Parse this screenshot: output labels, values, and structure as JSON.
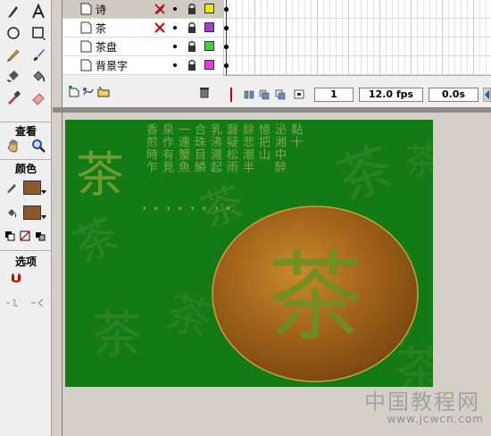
{
  "tools_panel": {
    "sections": {
      "view": "查看",
      "colors": "颜色",
      "options": "选项"
    },
    "tools": [
      "text-tool-icon",
      "oval-tool-icon",
      "rectangle-tool-icon",
      "pencil-tool-icon",
      "brush-tool-icon",
      "ink-bottle-tool-icon",
      "paint-bucket-tool-icon",
      "eyedropper-tool-icon",
      "eraser-tool-icon",
      "hand-tool-icon",
      "zoom-tool-icon"
    ],
    "stroke_color": "#8b5a2b",
    "fill_color": "#8b5a2b"
  },
  "timeline": {
    "layers": [
      {
        "name": "诗",
        "color": "#e8e800",
        "selected": true,
        "status": "pencil-crossed-icon"
      },
      {
        "name": "茶",
        "color": "#a040c0",
        "selected": false,
        "status": "red-x-icon"
      },
      {
        "name": "茶盘",
        "color": "#40d040",
        "selected": false,
        "status": ""
      },
      {
        "name": "背景字",
        "color": "#e040e0",
        "selected": false,
        "status": ""
      }
    ],
    "current_frame": "1",
    "frame_rate": "12.0 fps",
    "elapsed_time": "0.0s"
  },
  "stage": {
    "background": "#147a16",
    "plate_char": "茶",
    "poem_columns": [
      "香煎時乍",
      "泉作有見",
      "一連蟹魚",
      "合珠目鱗",
      "乳沸濺起",
      "磐疑松雨",
      "餘悲潮半",
      "憶把山",
      "泌湘中醉",
      "黏十"
    ],
    "poem_punctuation": "，。，。，。，。"
  },
  "watermark": {
    "line1": "中国教程网",
    "line2": "www.jcwcn.com"
  }
}
